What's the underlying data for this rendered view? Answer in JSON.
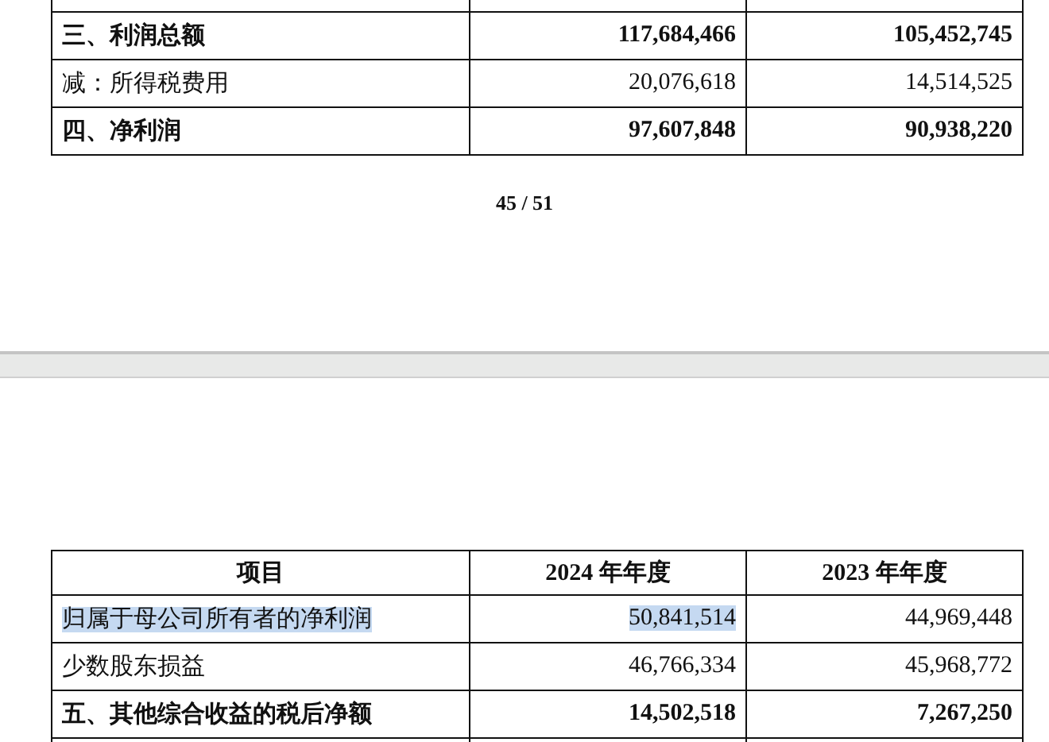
{
  "pages": [
    {
      "table": {
        "rows": [
          {
            "kind": "total",
            "highlighted": false,
            "label": "三、利润总额",
            "values": [
              "117,684,466",
              "105,452,745"
            ]
          },
          {
            "kind": "item",
            "highlighted": false,
            "label": "减：所得税费用",
            "values": [
              "20,076,618",
              "14,514,525"
            ]
          },
          {
            "kind": "total",
            "highlighted": false,
            "label": "四、净利润",
            "values": [
              "97,607,848",
              "90,938,220"
            ]
          }
        ]
      },
      "page_number": "45 / 51"
    },
    {
      "table": {
        "columns": [
          "项目",
          "2024 年年度",
          "2023 年年度"
        ],
        "rows": [
          {
            "kind": "item",
            "highlighted": true,
            "label": "归属于母公司所有者的净利润",
            "values": [
              "50,841,514",
              "44,969,448"
            ]
          },
          {
            "kind": "item",
            "highlighted": false,
            "label": "少数股东损益",
            "values": [
              "46,766,334",
              "45,968,772"
            ]
          },
          {
            "kind": "total",
            "highlighted": false,
            "label": "五、其他综合收益的税后净额",
            "values": [
              "14,502,518",
              "7,267,250"
            ]
          }
        ]
      }
    }
  ]
}
